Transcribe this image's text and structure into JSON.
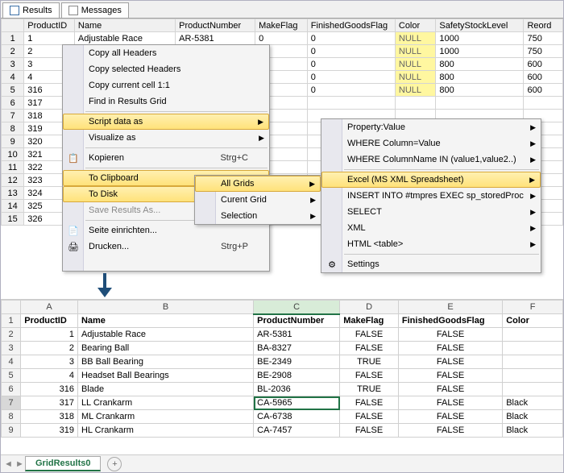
{
  "tabs": {
    "results": "Results",
    "messages": "Messages"
  },
  "grid": {
    "headers": [
      "ProductID",
      "Name",
      "ProductNumber",
      "MakeFlag",
      "FinishedGoodsFlag",
      "Color",
      "SafetyStockLevel",
      "Reord"
    ],
    "rows": [
      {
        "n": "1",
        "pid": "1",
        "name": "Adjustable Race",
        "pnum": "AR-5381",
        "mf": "0",
        "fgf": "0",
        "color": "NULL",
        "ssl": "1000",
        "re": "750"
      },
      {
        "n": "2",
        "pid": "2",
        "name": "",
        "pnum": "",
        "mf": "",
        "fgf": "0",
        "color": "NULL",
        "ssl": "1000",
        "re": "750"
      },
      {
        "n": "3",
        "pid": "3",
        "name": "",
        "pnum": "",
        "mf": "",
        "fgf": "0",
        "color": "NULL",
        "ssl": "800",
        "re": "600"
      },
      {
        "n": "4",
        "pid": "4",
        "name": "",
        "pnum": "",
        "mf": "",
        "fgf": "0",
        "color": "NULL",
        "ssl": "800",
        "re": "600"
      },
      {
        "n": "5",
        "pid": "316",
        "name": "",
        "pnum": "",
        "mf": "",
        "fgf": "0",
        "color": "NULL",
        "ssl": "800",
        "re": "600"
      },
      {
        "n": "6",
        "pid": "317",
        "name": "",
        "pnum": "",
        "mf": "",
        "fgf": "",
        "color": "",
        "ssl": "",
        "re": ""
      },
      {
        "n": "7",
        "pid": "318",
        "name": "",
        "pnum": "",
        "mf": "",
        "fgf": "",
        "color": "",
        "ssl": "",
        "re": ""
      },
      {
        "n": "8",
        "pid": "319",
        "name": "",
        "pnum": "",
        "mf": "",
        "fgf": "",
        "color": "",
        "ssl": "",
        "re": ""
      },
      {
        "n": "9",
        "pid": "320",
        "name": "",
        "pnum": "",
        "mf": "",
        "fgf": "",
        "color": "",
        "ssl": "",
        "re": ""
      },
      {
        "n": "10",
        "pid": "321",
        "name": "",
        "pnum": "",
        "mf": "",
        "fgf": "",
        "color": "",
        "ssl": "",
        "re": ""
      },
      {
        "n": "11",
        "pid": "322",
        "name": "",
        "pnum": "",
        "mf": "",
        "fgf": "",
        "color": "",
        "ssl": "",
        "re": ""
      },
      {
        "n": "12",
        "pid": "323",
        "name": "",
        "pnum": "",
        "mf": "",
        "fgf": "",
        "color": "",
        "ssl": "",
        "re": ""
      },
      {
        "n": "13",
        "pid": "324",
        "name": "",
        "pnum": "",
        "mf": "",
        "fgf": "",
        "color": "",
        "ssl": "",
        "re": ""
      },
      {
        "n": "14",
        "pid": "325",
        "name": "",
        "pnum": "",
        "mf": "",
        "fgf": "",
        "color": "",
        "ssl": "",
        "re": ""
      },
      {
        "n": "15",
        "pid": "326",
        "name": "",
        "pnum": "",
        "mf": "",
        "fgf": "",
        "color": "",
        "ssl": "",
        "re": ""
      }
    ]
  },
  "menu1": {
    "copyAllHeaders": "Copy all Headers",
    "copySelHeaders": "Copy selected Headers",
    "copyCell": "Copy current cell 1:1",
    "find": "Find in Results Grid",
    "scriptAs": "Script data as",
    "visualize": "Visualize as",
    "kopieren": "Kopieren",
    "kopierenKey": "Strg+C",
    "toClipboard": "To Clipboard",
    "toDisk": "To Disk",
    "saveResults": "Save Results As...",
    "seite": "Seite einrichten...",
    "drucken": "Drucken...",
    "druckenKey": "Strg+P"
  },
  "menu2": {
    "allGrids": "All Grids",
    "currentGrid": "Curent Grid",
    "selection": "Selection"
  },
  "menu3": {
    "propVal": "Property:Value",
    "whereCol": "WHERE Column=Value",
    "whereIn": "WHERE ColumnName IN (value1,value2..)",
    "excel": "Excel (MS XML Spreadsheet)",
    "insert": "INSERT INTO #tmpres EXEC sp_storedProc",
    "select": "SELECT",
    "xml": "XML",
    "html": "HTML <table>",
    "settings": "Settings"
  },
  "sheet": {
    "cols": [
      "A",
      "B",
      "C",
      "D",
      "E",
      "F"
    ],
    "hdr": {
      "a": "ProductID",
      "b": "Name",
      "c": "ProductNumber",
      "d": "MakeFlag",
      "e": "FinishedGoodsFlag",
      "f": "Color"
    },
    "rows": [
      {
        "n": "2",
        "a": "1",
        "b": "Adjustable Race",
        "c": "AR-5381",
        "d": "FALSE",
        "e": "FALSE",
        "f": ""
      },
      {
        "n": "3",
        "a": "2",
        "b": "Bearing Ball",
        "c": "BA-8327",
        "d": "FALSE",
        "e": "FALSE",
        "f": ""
      },
      {
        "n": "4",
        "a": "3",
        "b": "BB Ball Bearing",
        "c": "BE-2349",
        "d": "TRUE",
        "e": "FALSE",
        "f": ""
      },
      {
        "n": "5",
        "a": "4",
        "b": "Headset Ball Bearings",
        "c": "BE-2908",
        "d": "FALSE",
        "e": "FALSE",
        "f": ""
      },
      {
        "n": "6",
        "a": "316",
        "b": "Blade",
        "c": "BL-2036",
        "d": "TRUE",
        "e": "FALSE",
        "f": ""
      },
      {
        "n": "7",
        "a": "317",
        "b": "LL Crankarm",
        "c": "CA-5965",
        "d": "FALSE",
        "e": "FALSE",
        "f": "Black"
      },
      {
        "n": "8",
        "a": "318",
        "b": "ML Crankarm",
        "c": "CA-6738",
        "d": "FALSE",
        "e": "FALSE",
        "f": "Black"
      },
      {
        "n": "9",
        "a": "319",
        "b": "HL Crankarm",
        "c": "CA-7457",
        "d": "FALSE",
        "e": "FALSE",
        "f": "Black"
      }
    ],
    "tab": "GridResults0"
  }
}
